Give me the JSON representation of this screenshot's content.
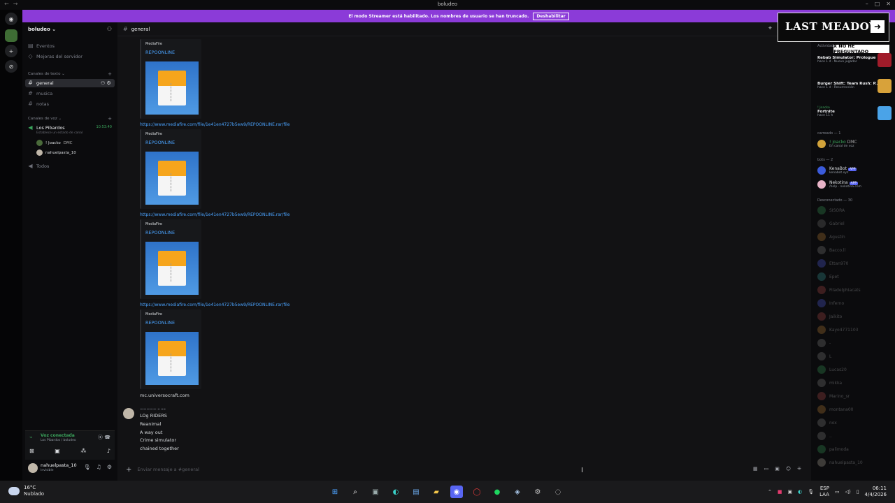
{
  "window": {
    "title": "boludeo"
  },
  "banner": {
    "text": "El modo Streamer está habilitado. Los nombres de usuario se han truncado.",
    "button": "Deshabilitar"
  },
  "server": {
    "name": "boludeo"
  },
  "sidebar": {
    "events": "Eventos",
    "boosts": "Mejoras del servidor",
    "text_category": "Canales de texto",
    "text_channels": [
      "general",
      "musica",
      "notas"
    ],
    "voice_category": "Canales de voz",
    "voice_channel": {
      "name": "Los Pibardos",
      "status": "Establece un estado de canal",
      "timer": "10:53:40"
    },
    "voice_users": [
      {
        "name": "! Joacko",
        "tag": "DMC"
      },
      {
        "name": "nahuelpasta_10"
      }
    ],
    "everyone": "Todos"
  },
  "voice_panel": {
    "status": "Voz conectada",
    "location": "Los Pibardos / boludeo"
  },
  "user_panel": {
    "name": "nahuelpasta_10",
    "status": "Invisible"
  },
  "channel": {
    "name": "general"
  },
  "messages": {
    "embeds": [
      {
        "provider": "MediaFire",
        "title": "REPOONLINE",
        "link": "https://www.mediafire.com/file/1e41en4727b5ew9/REPOONLINE.rar/file"
      },
      {
        "provider": "MediaFire",
        "title": "REPOONLINE",
        "link": "https://www.mediafire.com/file/1e41en4727b5ew9/REPOONLINE.rar/file"
      },
      {
        "provider": "MediaFire",
        "title": "REPOONLINE",
        "link": "https://www.mediafire.com/file/1e41en4727b5ew9/REPOONLINE.rar/file"
      },
      {
        "provider": "MediaFire",
        "title": "REPOONLINE",
        "link": "mc.universocraft.com"
      }
    ],
    "last_message": {
      "lines": [
        "LOg RIDERS",
        "Reanimal",
        "A way out",
        "Crime simulator",
        "chained together"
      ]
    }
  },
  "composer": {
    "placeholder": "Enviar mensaje a #general"
  },
  "members": {
    "activity_title": "Actividad",
    "activities": [
      {
        "game": "Kebab Simulator: Prologue",
        "sub": "hace 1 d · Nuevo jugador",
        "color": "#a01c2a"
      },
      {
        "game": "Burger Shift: Team Rush: P...",
        "sub": "hace 1 d · Resurrección",
        "color": "#d8a23a"
      },
      {
        "user": "! Joacko",
        "game": "Fortnite",
        "sub": "hace 11 h",
        "color": "#4aa3e8"
      }
    ],
    "playing_category": "carreado — 1",
    "playing": [
      {
        "name": "! Joacko",
        "tag": "DMC",
        "sub": "En canal de voz"
      }
    ],
    "bots_category": "bots — 2",
    "bots": [
      {
        "name": "KenaBot",
        "badge": "APP",
        "sub": "kenabot.xyz"
      },
      {
        "name": "Nekotina",
        "badge": "APP",
        "sub": "/help · nekotina.com"
      }
    ],
    "offline_category": "Desconectado — 30",
    "offline": [
      "SISORA",
      "Gabriel",
      "Agustín",
      "Bacco.ll",
      "Ettan970",
      "Epet",
      "Filadelphiacats",
      "Inferno",
      "Jaikito",
      "Kayo4771103",
      "-",
      "L",
      "Lucas20",
      "mikka",
      "Marino_sr",
      "montana00",
      "nox",
      "..",
      "palimoda",
      "nahuelpasta_10"
    ]
  },
  "overlay": {
    "title": "LAST MEADOW",
    "tag": "X NO HE PREGUNTADO"
  },
  "taskbar": {
    "weather_temp": "16°C",
    "weather_desc": "Nublado",
    "lang": "ESP",
    "lang_sub": "LAA",
    "time": "06:11",
    "date": "4/4/2026"
  }
}
